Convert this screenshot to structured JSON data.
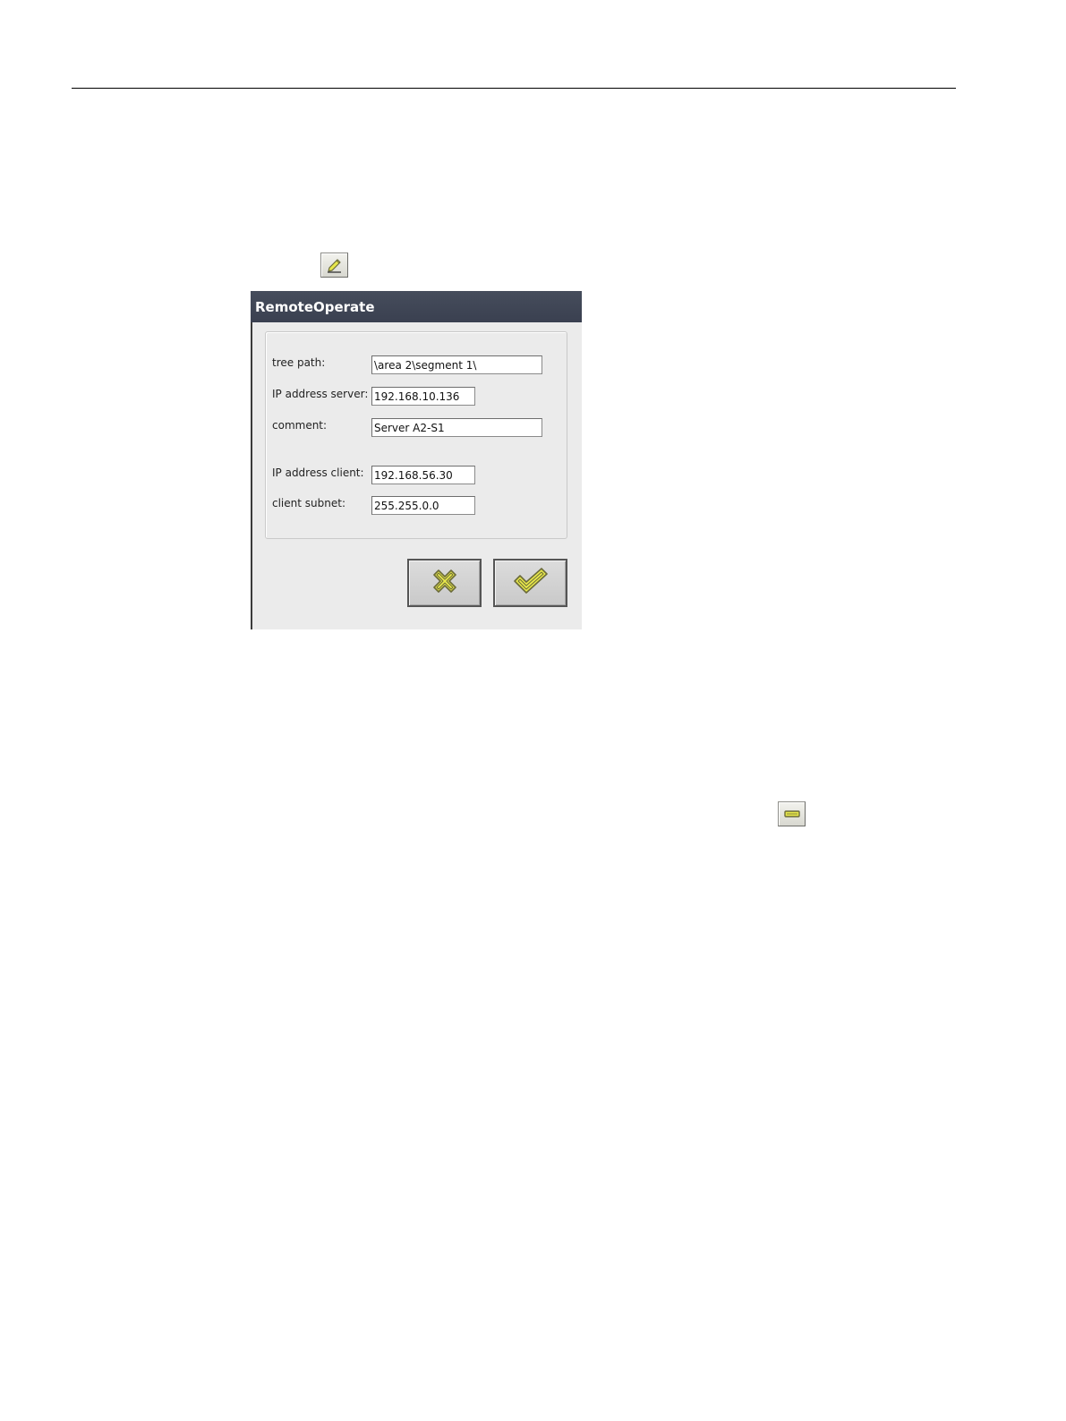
{
  "dialog": {
    "title": "RemoteOperate",
    "fields": {
      "tree_path": {
        "label": "tree path:",
        "value": "\\area 2\\segment 1\\"
      },
      "ip_server": {
        "label": "IP address server:",
        "value": "192.168.10.136"
      },
      "comment": {
        "label": "comment:",
        "value": "Server A2-S1"
      },
      "ip_client": {
        "label": "IP address client:",
        "value": "192.168.56.30"
      },
      "client_subnet": {
        "label": "client subnet:",
        "value": "255.255.0.0"
      }
    },
    "buttons": {
      "cancel_icon": "x-icon",
      "ok_icon": "checkmark-icon"
    }
  },
  "toolbar_icons": {
    "edit": "pencil-edit-icon",
    "remove": "minus-icon"
  },
  "colors": {
    "titlebar": "#3f4555",
    "icon_yellow": "#e8e84a",
    "icon_outline": "#6b6b3a",
    "dialog_bg": "#ebebeb"
  }
}
